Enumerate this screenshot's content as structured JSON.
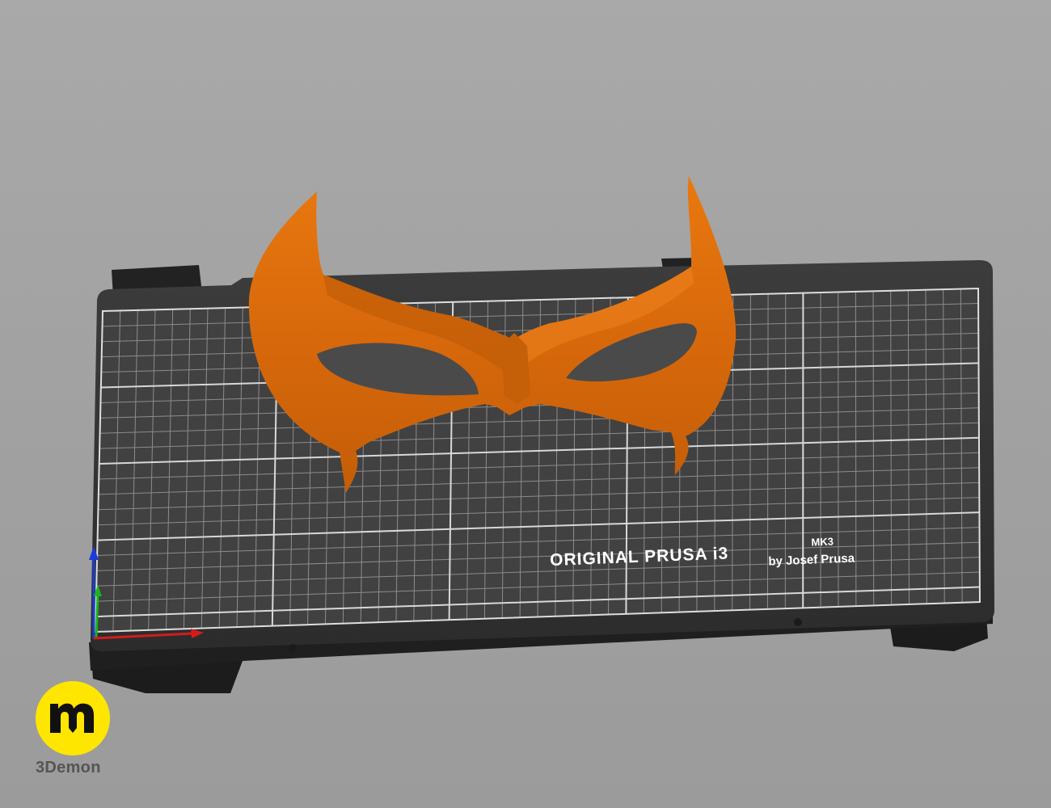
{
  "scene": {
    "background_color": "#a5a5a5",
    "model_color": "#d8690b",
    "bed_color": "#2b2b2b"
  },
  "print_bed": {
    "brand_line1": "ORIGINAL PRUSA i3",
    "brand_model": "MK3",
    "brand_line2": "by Josef Prusa"
  },
  "axes": {
    "x_color": "#d41c1c",
    "y_color": "#1cb41c",
    "z_color": "#1c3cd8"
  },
  "watermark": {
    "name": "3Demon",
    "icon": "3demon-logo-icon",
    "color": "#ffe600"
  }
}
